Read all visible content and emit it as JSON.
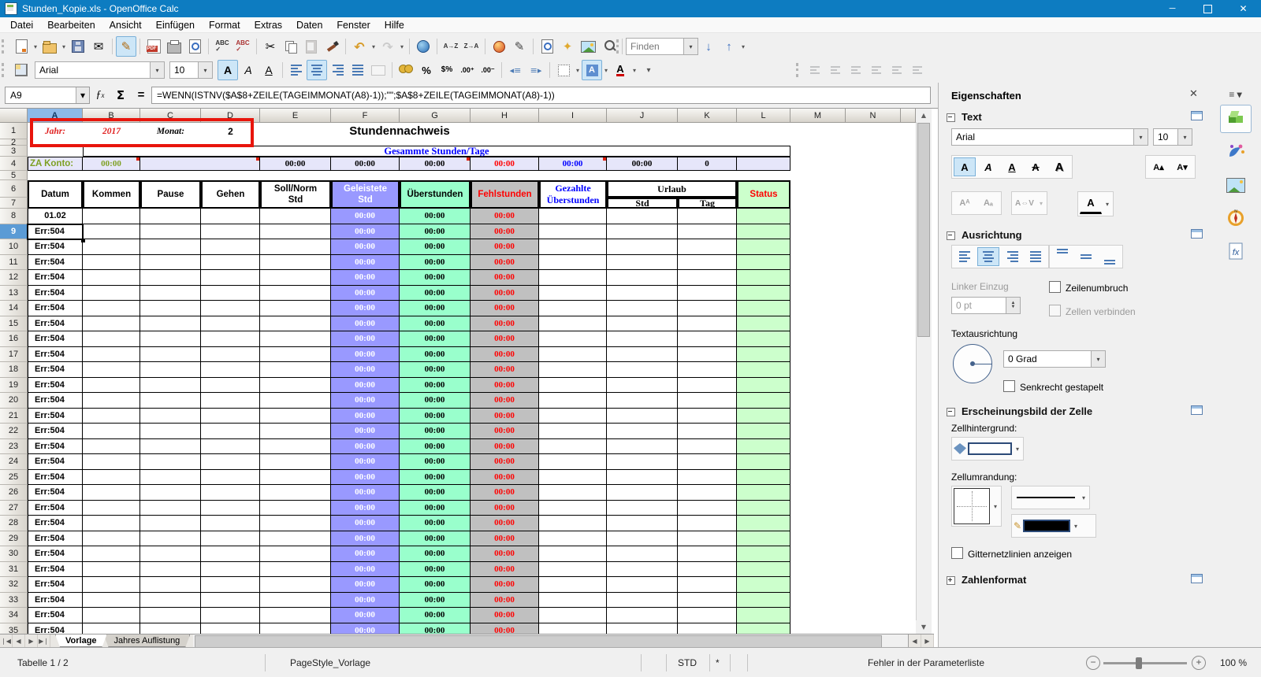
{
  "window": {
    "title": "Stunden_Kopie.xls - OpenOffice Calc"
  },
  "menubar": {
    "items": [
      "Datei",
      "Bearbeiten",
      "Ansicht",
      "Einfügen",
      "Format",
      "Extras",
      "Daten",
      "Fenster",
      "Hilfe"
    ]
  },
  "standard_toolbar": {
    "icons": [
      {
        "name": "new-document",
        "dropdown": true
      },
      {
        "name": "open",
        "dropdown": true
      },
      {
        "name": "save"
      },
      {
        "name": "send-email"
      },
      {
        "sep": true
      },
      {
        "name": "edit-file",
        "active": true
      },
      {
        "sep": true
      },
      {
        "name": "export-pdf"
      },
      {
        "name": "print"
      },
      {
        "name": "page-preview"
      },
      {
        "sep": true
      },
      {
        "name": "spellcheck"
      },
      {
        "name": "auto-spellcheck"
      },
      {
        "sep": true
      },
      {
        "name": "cut"
      },
      {
        "name": "copy"
      },
      {
        "name": "paste",
        "disabled": true
      },
      {
        "name": "format-paintbrush"
      },
      {
        "sep": true
      },
      {
        "name": "undo",
        "dropdown": true
      },
      {
        "name": "redo",
        "disabled": true,
        "dropdown": true
      },
      {
        "sep": true
      },
      {
        "name": "hyperlink"
      },
      {
        "sep": true
      },
      {
        "name": "sort-ascending"
      },
      {
        "name": "sort-descending"
      },
      {
        "sep": true
      },
      {
        "name": "insert-chart"
      },
      {
        "name": "show-draw-functions"
      },
      {
        "sep": true
      },
      {
        "name": "find-replace"
      },
      {
        "name": "navigator"
      },
      {
        "name": "gallery"
      },
      {
        "name": "zoom"
      },
      {
        "sep": true
      },
      {
        "name": "help"
      },
      {
        "name": "toolbar-overflow"
      }
    ]
  },
  "find_bar": {
    "value": "Finden",
    "down_label": "search-down",
    "up_label": "search-up"
  },
  "formatting_toolbar": {
    "font_name": "Arial",
    "font_size": "10",
    "icons_left": [
      {
        "name": "view-grid"
      }
    ],
    "icons_right": [
      {
        "name": "bold",
        "active": true
      },
      {
        "name": "italic"
      },
      {
        "name": "underline"
      },
      {
        "sep": true
      },
      {
        "name": "align-left"
      },
      {
        "name": "align-center",
        "active": true
      },
      {
        "name": "align-right"
      },
      {
        "name": "align-justified"
      },
      {
        "name": "merge-cells",
        "disabled": true
      },
      {
        "sep": true
      },
      {
        "name": "currency"
      },
      {
        "name": "percent"
      },
      {
        "name": "number-format-standard"
      },
      {
        "name": "add-decimal"
      },
      {
        "name": "delete-decimal"
      },
      {
        "sep": true
      },
      {
        "name": "decrease-indent"
      },
      {
        "name": "increase-indent"
      },
      {
        "sep": true
      },
      {
        "name": "borders",
        "dropdown": true
      },
      {
        "name": "background-color",
        "dropdown": true,
        "active": true
      },
      {
        "name": "font-color",
        "dropdown": true
      },
      {
        "name": "toolbar-overflow"
      }
    ],
    "object_align_icons": [
      "object-align-left",
      "object-center-horizontal",
      "object-align-right",
      "object-align-top",
      "object-center-vertical",
      "object-align-bottom"
    ]
  },
  "formula_bar": {
    "cell_reference": "A9",
    "formula": "=WENN(ISTNV($A$8+ZEILE(TAGEIMMONAT(A8)-1));\"\";$A$8+ZEILE(TAGEIMMONAT(A8)-1))"
  },
  "sheet": {
    "columns": [
      "A",
      "B",
      "C",
      "D",
      "E",
      "F",
      "G",
      "H",
      "I",
      "J",
      "K",
      "L",
      "M",
      "N"
    ],
    "visible_rows": {
      "first": 1,
      "last": 35
    },
    "selected_column": "A",
    "selected_row": 9,
    "active_cell": "A9",
    "row1": {
      "jahr_label": "Jahr:",
      "jahr_value": "2017",
      "monat_label": "Monat:",
      "monat_value": "2",
      "title": "Stundennachweis"
    },
    "row3_label": "Gesammte Stunden/Tage",
    "row4": {
      "za_label": "ZA Konto:",
      "za_value": "00:00",
      "e": "00:00",
      "f": "00:00",
      "g": "00:00",
      "h": "00:00",
      "i": "00:00",
      "j": "00:00",
      "k": "0"
    },
    "table_headers": {
      "datum": "Datum",
      "kommen": "Kommen",
      "pause": "Pause",
      "gehen": "Gehen",
      "soll_1": "Soll/Norm",
      "soll_2": "Std",
      "geleistete_1": "Geleistete",
      "geleistete_2": "Std",
      "ueberstunden": "Überstunden",
      "fehlstunden": "Fehlstunden",
      "gezahlte_1": "Gezahlte",
      "gezahlte_2": "Überstunden",
      "urlaub": "Urlaub",
      "urlaub_std": "Std",
      "urlaub_tag": "Tag",
      "status": "Status"
    },
    "time_value": "00:00",
    "rows": [
      {
        "n": 8,
        "datum": "01.02"
      },
      {
        "n": 9,
        "datum": "Err:504"
      },
      {
        "n": 10,
        "datum": "Err:504"
      },
      {
        "n": 11,
        "datum": "Err:504"
      },
      {
        "n": 12,
        "datum": "Err:504"
      },
      {
        "n": 13,
        "datum": "Err:504"
      },
      {
        "n": 14,
        "datum": "Err:504"
      },
      {
        "n": 15,
        "datum": "Err:504"
      },
      {
        "n": 16,
        "datum": "Err:504"
      },
      {
        "n": 17,
        "datum": "Err:504"
      },
      {
        "n": 18,
        "datum": "Err:504"
      },
      {
        "n": 19,
        "datum": "Err:504"
      },
      {
        "n": 20,
        "datum": "Err:504"
      },
      {
        "n": 21,
        "datum": "Err:504"
      },
      {
        "n": 22,
        "datum": "Err:504"
      },
      {
        "n": 23,
        "datum": "Err:504"
      },
      {
        "n": 24,
        "datum": "Err:504"
      },
      {
        "n": 25,
        "datum": "Err:504"
      },
      {
        "n": 26,
        "datum": "Err:504"
      },
      {
        "n": 27,
        "datum": "Err:504"
      },
      {
        "n": 28,
        "datum": "Err:504"
      },
      {
        "n": 29,
        "datum": "Err:504"
      },
      {
        "n": 30,
        "datum": "Err:504"
      },
      {
        "n": 31,
        "datum": "Err:504"
      },
      {
        "n": 32,
        "datum": "Err:504"
      },
      {
        "n": 33,
        "datum": "Err:504"
      },
      {
        "n": 34,
        "datum": "Err:504"
      },
      {
        "n": 35,
        "datum": "Err:504"
      }
    ]
  },
  "sheet_tabs": {
    "tabs": [
      "Vorlage",
      "Jahres Auflistung"
    ],
    "active": "Vorlage"
  },
  "status_bar": {
    "sheet_info": "Tabelle 1 / 2",
    "page_style": "PageStyle_Vorlage",
    "selection_mode": "STD",
    "modified_flag": "*",
    "message": "Fehler in der Parameterliste",
    "zoom_level": "100 %"
  },
  "sidebar": {
    "title": "Eigenschaften",
    "text_section": {
      "title": "Text",
      "font_name": "Arial",
      "font_size": "10"
    },
    "alignment_section": {
      "title": "Ausrichtung",
      "left_indent_label": "Linker Einzug",
      "indent_value": "0 pt",
      "wrap_text_label": "Zeilenumbruch",
      "merge_cells_label": "Zellen verbinden",
      "text_orientation_label": "Textausrichtung",
      "rotation_value": "0 Grad",
      "stacked_label": "Senkrecht gestapelt"
    },
    "cell_appearance_section": {
      "title": "Erscheinungsbild der Zelle",
      "background_label": "Zellhintergrund:",
      "border_label": "Zellumrandung:",
      "gridlines_label": "Gitternetzlinien anzeigen"
    },
    "number_format_section": {
      "title": "Zahlenformat"
    }
  },
  "colors": {
    "titlebar": "#0d7cc1",
    "col_f_bg": "#9999FF",
    "col_g_bg": "#99FFCC",
    "col_h_bg": "#C0C0C0",
    "col_l_bg": "#CCFFCC",
    "row4_bg": "#E6E6FA",
    "annotation_red": "#E8150C",
    "error_red": "#FF0000",
    "value_blue": "#0000FF",
    "za_green": "#7EA023"
  }
}
